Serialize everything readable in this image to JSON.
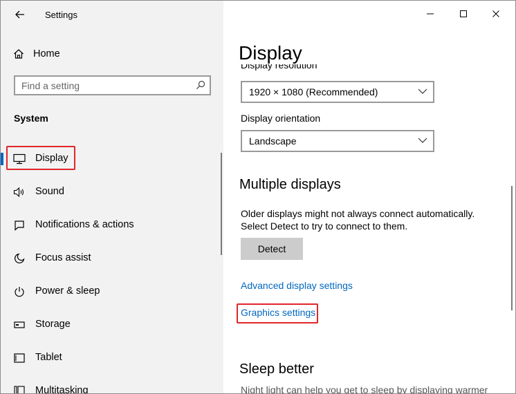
{
  "window": {
    "title": "Settings"
  },
  "sidebar": {
    "home_label": "Home",
    "search_placeholder": "Find a setting",
    "section_label": "System",
    "items": [
      {
        "label": "Display",
        "icon": "monitor-icon",
        "active": true
      },
      {
        "label": "Sound",
        "icon": "speaker-icon"
      },
      {
        "label": "Notifications & actions",
        "icon": "notification-icon"
      },
      {
        "label": "Focus assist",
        "icon": "moon-icon"
      },
      {
        "label": "Power & sleep",
        "icon": "power-icon"
      },
      {
        "label": "Storage",
        "icon": "storage-icon"
      },
      {
        "label": "Tablet",
        "icon": "tablet-icon"
      },
      {
        "label": "Multitasking",
        "icon": "multitasking-icon"
      }
    ]
  },
  "main": {
    "title": "Display",
    "resolution": {
      "label": "Display resolution",
      "value": "1920 × 1080 (Recommended)"
    },
    "orientation": {
      "label": "Display orientation",
      "value": "Landscape"
    },
    "multiple_displays": {
      "heading": "Multiple displays",
      "line1": "Older displays might not always connect automatically.",
      "line2": "Select Detect to try to connect to them.",
      "detect_label": "Detect"
    },
    "links": {
      "advanced": "Advanced display settings",
      "graphics": "Graphics settings"
    },
    "sleep": {
      "heading": "Sleep better",
      "desc": "Night light can help you get to sleep by displaying warmer"
    }
  },
  "colors": {
    "accent": "#0067c0",
    "highlight": "#e0252a",
    "sidebar_bg": "#f2f2f2"
  }
}
